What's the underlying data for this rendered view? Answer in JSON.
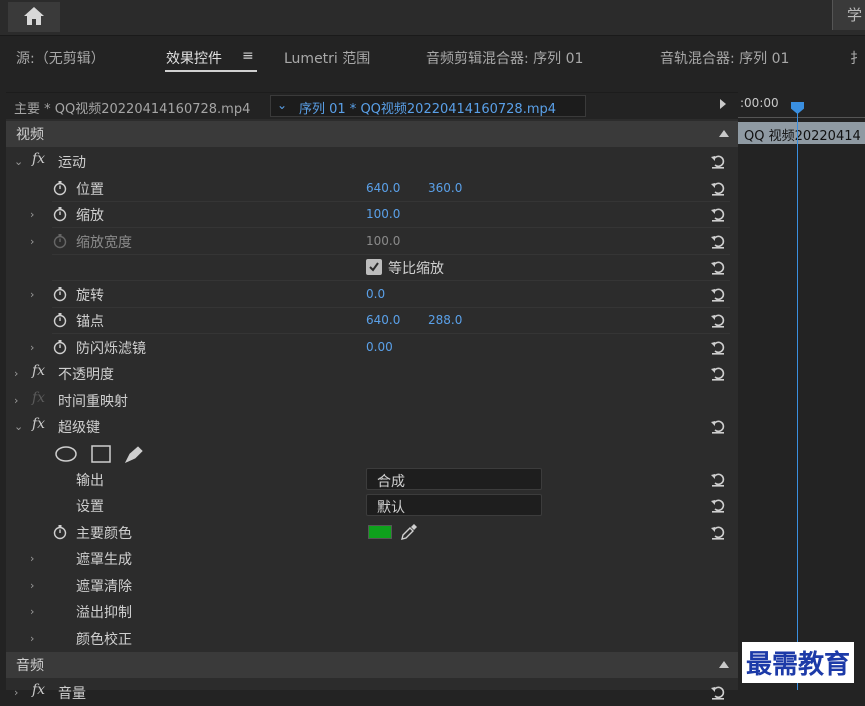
{
  "topbar": {
    "right_label": "学"
  },
  "tabs": [
    {
      "label": "源:（无剪辑）"
    },
    {
      "label": "效果控件"
    },
    {
      "label": "Lumetri 范围"
    },
    {
      "label": "音频剪辑混合器: 序列 01"
    },
    {
      "label": "音轨混合器: 序列 01"
    },
    {
      "label": "扌"
    }
  ],
  "tab_menu_icon": "≡",
  "source_bar": {
    "master": "主要 * QQ视频20220414160728.mp4",
    "sequence": "序列 01 * QQ视频20220414160728.mp4"
  },
  "video_section": "视频",
  "audio_section": "音频",
  "effects": {
    "motion": {
      "name": "运动",
      "position": {
        "label": "位置",
        "x": "640.0",
        "y": "360.0"
      },
      "scale": {
        "label": "缩放",
        "value": "100.0"
      },
      "scale_width": {
        "label": "缩放宽度",
        "value": "100.0"
      },
      "uniform_scale": {
        "label": "等比缩放",
        "checked": true
      },
      "rotation": {
        "label": "旋转",
        "value": "0.0"
      },
      "anchor": {
        "label": "锚点",
        "x": "640.0",
        "y": "288.0"
      },
      "anti_flicker": {
        "label": "防闪烁滤镜",
        "value": "0.00"
      }
    },
    "opacity": {
      "name": "不透明度"
    },
    "time_remap": {
      "name": "时间重映射"
    },
    "ultra_key": {
      "name": "超级键",
      "output": {
        "label": "输出",
        "value": "合成"
      },
      "setting": {
        "label": "设置",
        "value": "默认"
      },
      "key_color": {
        "label": "主要颜色",
        "color": "#0ea11c"
      },
      "matte_generation": "遮罩生成",
      "matte_cleanup": "遮罩清除",
      "spill_suppression": "溢出抑制",
      "color_correction": "颜色校正"
    },
    "audio_volume": {
      "name": "音量"
    }
  },
  "timeline": {
    "timecode": ":00:00",
    "clip_name": "QQ 视频20220414"
  },
  "watermark": "最需教育"
}
